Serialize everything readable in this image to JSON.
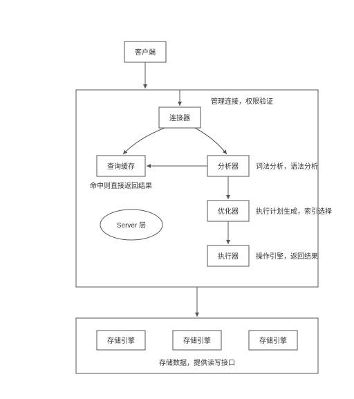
{
  "nodes": {
    "client": "客户端",
    "connector": "连接器",
    "cache": "查询缓存",
    "analyzer": "分析器",
    "optimizer": "优化器",
    "executor": "执行器",
    "storage1": "存储引擎",
    "storage2": "存储引擎",
    "storage3": "存储引擎",
    "server_layer": "Server 层"
  },
  "annotations": {
    "connector_note": "管理连接，权限验证",
    "analyzer_note": "词法分析，语法分析",
    "optimizer_note": "执行计划生成，索引选择",
    "executor_note": "操作引擎，返回结果",
    "cache_note": "命中则直接返回结果",
    "storage_note": "存储数据，提供读写接口"
  }
}
